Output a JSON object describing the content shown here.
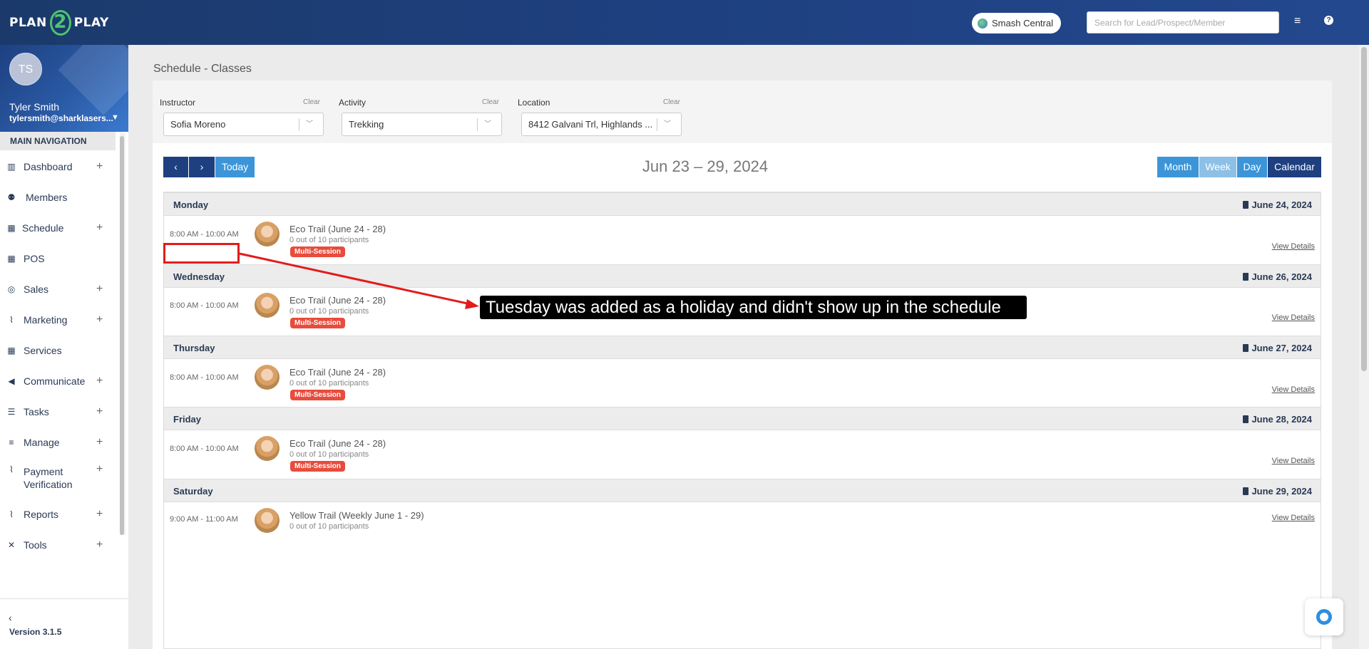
{
  "header": {
    "logo_text_left": "PLAN",
    "logo_text_mid": "2",
    "logo_text_right": "PLAY",
    "club_name": "Smash Central",
    "search_placeholder": "Search for Lead/Prospect/Member",
    "menu_icon": "hamburger-icon",
    "help_icon": "question-icon"
  },
  "profile": {
    "initials": "TS",
    "name": "Tyler Smith",
    "email": "tylersmith@sharklasers..."
  },
  "sidebar": {
    "header": "MAIN NAVIGATION",
    "items": [
      {
        "label": "Dashboard",
        "icon": "chart-icon",
        "expandable": true
      },
      {
        "label": "Members",
        "icon": "users-icon",
        "expandable": false
      },
      {
        "label": "Schedule",
        "icon": "calendar-icon",
        "expandable": true
      },
      {
        "label": "POS",
        "icon": "grid-icon",
        "expandable": false
      },
      {
        "label": "Sales",
        "icon": "target-icon",
        "expandable": true
      },
      {
        "label": "Marketing",
        "icon": "line-chart-icon",
        "expandable": true
      },
      {
        "label": "Services",
        "icon": "grid-icon",
        "expandable": false
      },
      {
        "label": "Communicate",
        "icon": "megaphone-icon",
        "expandable": true
      },
      {
        "label": "Tasks",
        "icon": "list-icon",
        "expandable": true
      },
      {
        "label": "Manage",
        "icon": "bars-icon",
        "expandable": true
      },
      {
        "label_line1": "Payment",
        "label_line2": "Verification",
        "icon": "line-chart-icon",
        "expandable": true
      },
      {
        "label": "Reports",
        "icon": "line-chart-icon",
        "expandable": true
      },
      {
        "label": "Tools",
        "icon": "tools-icon",
        "expandable": true
      }
    ],
    "version": "Version 3.1.5"
  },
  "page": {
    "title": "Schedule - Classes"
  },
  "filters": {
    "instructor": {
      "label": "Instructor",
      "clear": "Clear",
      "value": "Sofia Moreno"
    },
    "activity": {
      "label": "Activity",
      "clear": "Clear",
      "value": "Trekking"
    },
    "location": {
      "label": "Location",
      "clear": "Clear",
      "value": "8412 Galvani Trl, Highlands ..."
    }
  },
  "toolbar": {
    "prev": "‹",
    "next": "›",
    "today": "Today",
    "range": "Jun 23 – 29, 2024",
    "views": [
      "Month",
      "Week",
      "Day",
      "Calendar"
    ],
    "active_view": "Week"
  },
  "schedule": [
    {
      "day": "Monday",
      "date": "June 24, 2024",
      "time": "8:00 AM - 10:00 AM",
      "name": "Eco Trail (June 24 - 28)",
      "participants": "0 out of 10 participants",
      "badge": "Multi-Session",
      "link": "View Details"
    },
    {
      "day": "Wednesday",
      "date": "June 26, 2024",
      "time": "8:00 AM - 10:00 AM",
      "name": "Eco Trail (June 24 - 28)",
      "participants": "0 out of 10 participants",
      "badge": "Multi-Session",
      "link": "View Details"
    },
    {
      "day": "Thursday",
      "date": "June 27, 2024",
      "time": "8:00 AM - 10:00 AM",
      "name": "Eco Trail (June 24 - 28)",
      "participants": "0 out of 10 participants",
      "badge": "Multi-Session",
      "link": "View Details"
    },
    {
      "day": "Friday",
      "date": "June 28, 2024",
      "time": "8:00 AM - 10:00 AM",
      "name": "Eco Trail (June 24 - 28)",
      "participants": "0 out of 10 participants",
      "badge": "Multi-Session",
      "link": "View Details"
    },
    {
      "day": "Saturday",
      "date": "June 29, 2024",
      "time": "9:00 AM - 11:00 AM",
      "name": "Yellow Trail (Weekly June 1 - 29)",
      "participants": "0 out of 10 participants",
      "badge": "",
      "link": "View Details"
    }
  ],
  "annotation": {
    "text": "Tuesday was added as a holiday and didn't show up in the schedule",
    "color": "#e31b1b"
  },
  "colors": {
    "primary": "#1e4080",
    "accent": "#3b95d8",
    "badge": "#e74c3c",
    "logo_green": "#4fc36e"
  }
}
